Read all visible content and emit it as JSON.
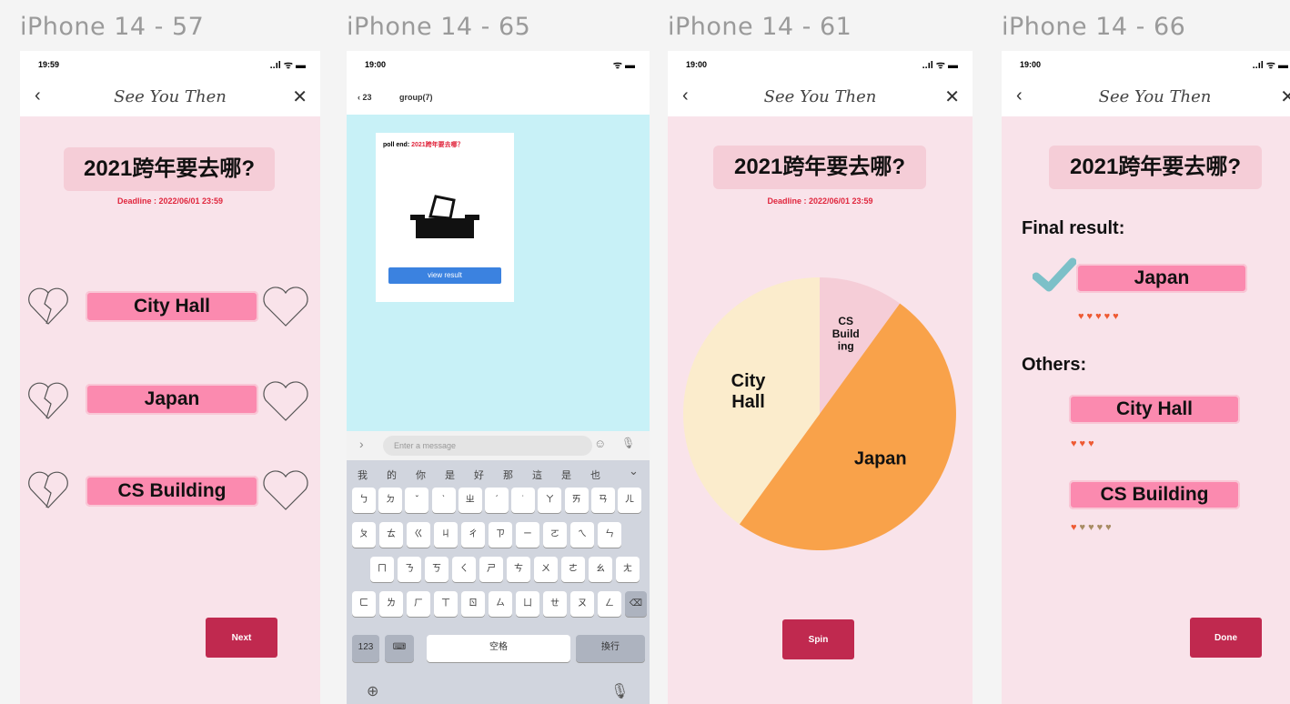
{
  "frames": [
    {
      "label": "iPhone 14 - 57"
    },
    {
      "label": "iPhone 14 - 65"
    },
    {
      "label": "iPhone 14 - 61"
    },
    {
      "label": "iPhone 14 - 66"
    }
  ],
  "status": {
    "time_a": "19:59",
    "time_b": "19:00",
    "signal": "..ıl ᯤ ▬"
  },
  "nav": {
    "title": "See You Then",
    "back": "‹",
    "close": "✕"
  },
  "question": "2021跨年要去哪?",
  "deadline_a": "Deadline : 2022/06/01 23:59",
  "deadline_b": "Deadline : 2022/06/01 23:59",
  "options": [
    "City Hall",
    "Japan",
    "CS Building"
  ],
  "next_label": "Next",
  "chat": {
    "back_label": "‹ 23",
    "group_name": "group(7)",
    "poll_prefix": "poll end: ",
    "poll_highlight": "2021跨年要去哪？",
    "view_result": "view result",
    "input_placeholder": "Enter a message"
  },
  "keyboard": {
    "row0": [
      "我",
      "的",
      "你",
      "是",
      "好",
      "那",
      "這",
      "是",
      "也"
    ],
    "row1": [
      "ㄅ",
      "ㄉ",
      "ˇ",
      "ˋ",
      "ㄓ",
      "ˊ",
      "˙",
      "ㄚ",
      "ㄞ",
      "ㄢ",
      "ㄦ"
    ],
    "row2": [
      "ㄆ",
      "ㄊ",
      "ㄍ",
      "ㄐ",
      "ㄔ",
      "ㄗ",
      "ㄧ",
      "ㄛ",
      "ㄟ",
      "ㄣ"
    ],
    "row3": [
      "ㄇ",
      "ㄋ",
      "ㄎ",
      "ㄑ",
      "ㄕ",
      "ㄘ",
      "ㄨ",
      "ㄜ",
      "ㄠ",
      "ㄤ"
    ],
    "row4": [
      "ㄈ",
      "ㄌ",
      "ㄏ",
      "ㄒ",
      "ㄖ",
      "ㄙ",
      "ㄩ",
      "ㄝ",
      "ㄡ",
      "ㄥ"
    ],
    "k123": "123",
    "space": "空格",
    "enter": "換行"
  },
  "chart_data": {
    "type": "pie",
    "slices": [
      {
        "label": "CS Building",
        "display": "CS\nBuild\ning",
        "value": 1,
        "color": "#f5cdd7"
      },
      {
        "label": "Japan",
        "value": 5,
        "color": "#f9a24a"
      },
      {
        "label": "City Hall",
        "value": 4,
        "color": "#fbeccc"
      }
    ]
  },
  "spin_label": "Spin",
  "result": {
    "final_label": "Final result:",
    "winner": "Japan",
    "winner_hearts": "♥♥♥♥♥",
    "others_label": "Others:",
    "others": [
      {
        "name": "City Hall",
        "hearts": "♥♥♥",
        "broken": ""
      },
      {
        "name": "CS Building",
        "hearts": "♥",
        "broken": "♥♥♥♥"
      }
    ]
  },
  "done_label": "Done",
  "colors": {
    "pink_bg": "#f9e3ea",
    "pill": "#fb8aaf",
    "button": "#c0294f",
    "chat_bg": "#c8f1f7",
    "deadline": "#e0263d"
  }
}
